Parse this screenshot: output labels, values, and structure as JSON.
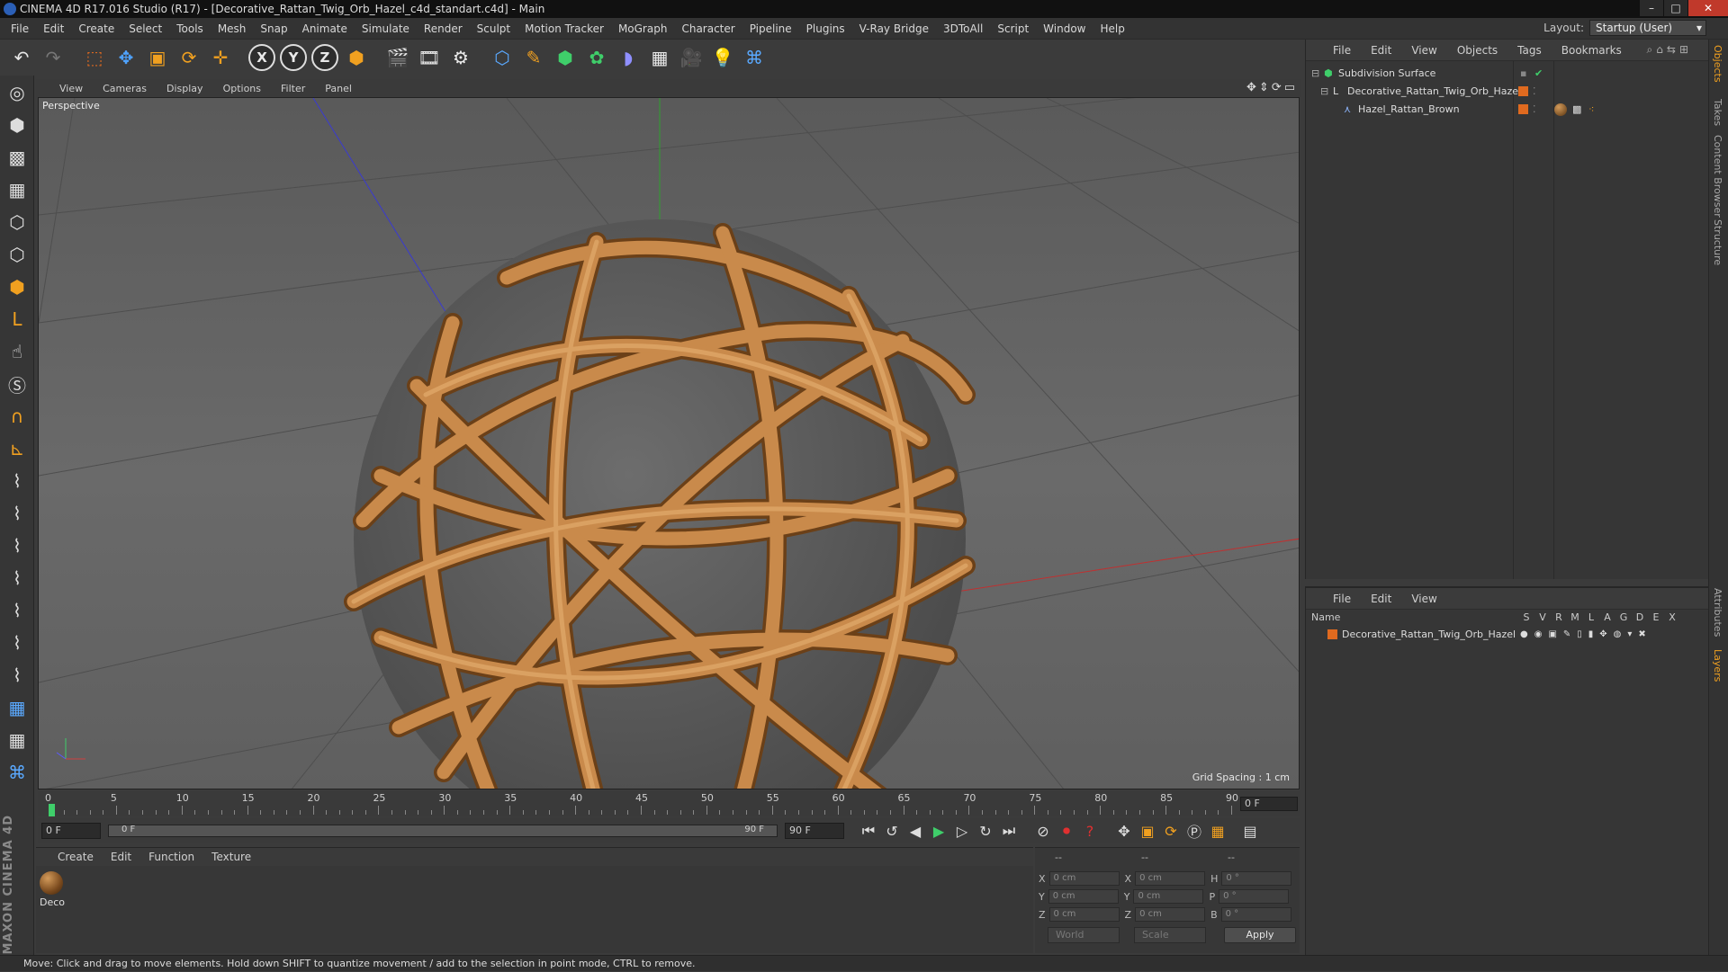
{
  "window": {
    "title": "CINEMA 4D R17.016 Studio (R17) - [Decorative_Rattan_Twig_Orb_Hazel_c4d_standart.c4d] - Main"
  },
  "menubar": {
    "items": [
      "File",
      "Edit",
      "Create",
      "Select",
      "Tools",
      "Mesh",
      "Snap",
      "Animate",
      "Simulate",
      "Render",
      "Sculpt",
      "Motion Tracker",
      "MoGraph",
      "Character",
      "Pipeline",
      "Plugins",
      "V-Ray Bridge",
      "3DToAll",
      "Script",
      "Window",
      "Help"
    ],
    "layout_label": "Layout:",
    "layout_value": "Startup (User)"
  },
  "toolbar": {
    "axis_x": "X",
    "axis_y": "Y",
    "axis_z": "Z"
  },
  "viewport": {
    "menu": [
      "View",
      "Cameras",
      "Display",
      "Options",
      "Filter",
      "Panel"
    ],
    "camera_label": "Perspective",
    "grid_spacing": "Grid Spacing : 1 cm"
  },
  "timeline": {
    "ticks": [
      "0",
      "5",
      "10",
      "15",
      "20",
      "25",
      "30",
      "35",
      "40",
      "45",
      "50",
      "55",
      "60",
      "65",
      "70",
      "75",
      "80",
      "85",
      "90"
    ],
    "current_frame": "0 F",
    "start_frame": "0 F",
    "range_start": "0 F",
    "range_end": "90 F",
    "end_frame": "90 F"
  },
  "material_panel": {
    "menu": [
      "Create",
      "Edit",
      "Function",
      "Texture"
    ],
    "materials": [
      {
        "label": "Deco"
      }
    ]
  },
  "coordinates": {
    "headers": [
      "--",
      "--",
      "--"
    ],
    "rows": [
      {
        "a": "X",
        "av": "0 cm",
        "b": "X",
        "bv": "0 cm",
        "c": "H",
        "cv": "0 °"
      },
      {
        "a": "Y",
        "av": "0 cm",
        "b": "Y",
        "bv": "0 cm",
        "c": "P",
        "cv": "0 °"
      },
      {
        "a": "Z",
        "av": "0 cm",
        "b": "Z",
        "bv": "0 cm",
        "c": "B",
        "cv": "0 °"
      }
    ],
    "mode": "World",
    "size_mode": "Scale",
    "apply": "Apply"
  },
  "object_manager": {
    "menu": [
      "File",
      "Edit",
      "View",
      "Objects",
      "Tags",
      "Bookmarks"
    ],
    "objects": [
      {
        "name": "Subdivision Surface"
      },
      {
        "name": "Decorative_Rattan_Twig_Orb_Hazel"
      },
      {
        "name": "Hazel_Rattan_Brown"
      }
    ]
  },
  "layer_manager": {
    "menu": [
      "File",
      "Edit",
      "View"
    ],
    "name_header": "Name",
    "columns": [
      "S",
      "V",
      "R",
      "M",
      "L",
      "A",
      "G",
      "D",
      "E",
      "X"
    ],
    "layers": [
      {
        "name": "Decorative_Rattan_Twig_Orb_Hazel"
      }
    ]
  },
  "right_tabs": [
    "Objects",
    "Takes",
    "Content Browser",
    "Structure",
    "Attributes",
    "Layers"
  ],
  "branding": "MAXON CINEMA 4D",
  "status": {
    "text": "Move: Click and drag to move elements. Hold down SHIFT to quantize movement / add to the selection in point mode, CTRL to remove."
  },
  "colors": {
    "accent_orange": "#e06a1f",
    "rattan": "#c98a4b"
  }
}
